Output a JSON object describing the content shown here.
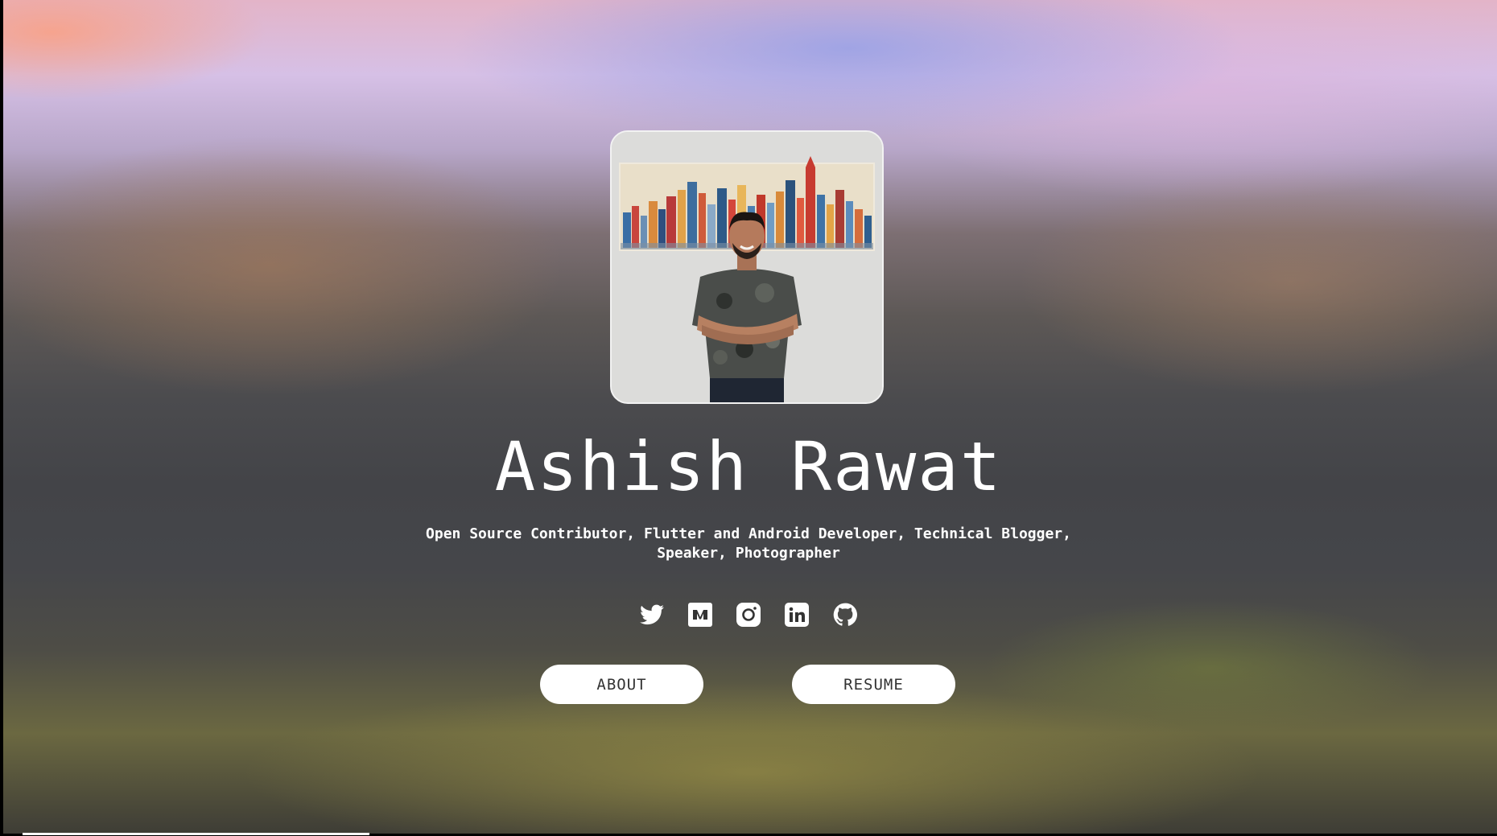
{
  "profile": {
    "name": "Ashish Rawat",
    "tagline": "Open Source Contributor, Flutter and Android Developer, Technical Blogger, Speaker, Photographer",
    "photo_icon": "profile-photo"
  },
  "socials": [
    {
      "name": "twitter",
      "icon": "twitter-icon"
    },
    {
      "name": "medium",
      "icon": "medium-icon"
    },
    {
      "name": "instagram",
      "icon": "instagram-icon"
    },
    {
      "name": "linkedin",
      "icon": "linkedin-icon"
    },
    {
      "name": "github",
      "icon": "github-icon"
    }
  ],
  "buttons": {
    "about_label": "ABOUT",
    "resume_label": "RESUME"
  },
  "colors": {
    "text": "#ffffff",
    "button_bg": "#ffffff",
    "button_text": "#333333"
  }
}
